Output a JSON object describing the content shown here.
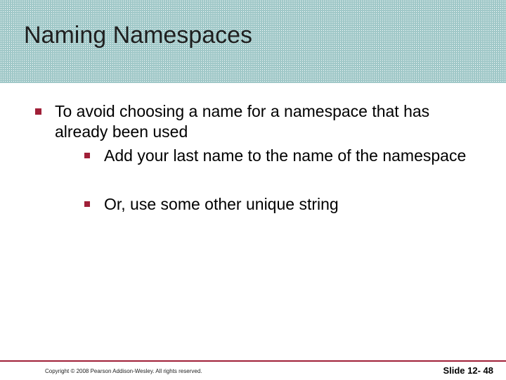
{
  "title": "Naming Namespaces",
  "content": {
    "point1": "To avoid choosing a name for a namespace that has already been used",
    "sub1": "Add your last name to the name of the namespace",
    "sub2": "Or, use some other unique string"
  },
  "footer": {
    "copyright": "Copyright © 2008 Pearson Addison-Wesley. All rights reserved.",
    "slide_number": "Slide 12- 48"
  }
}
